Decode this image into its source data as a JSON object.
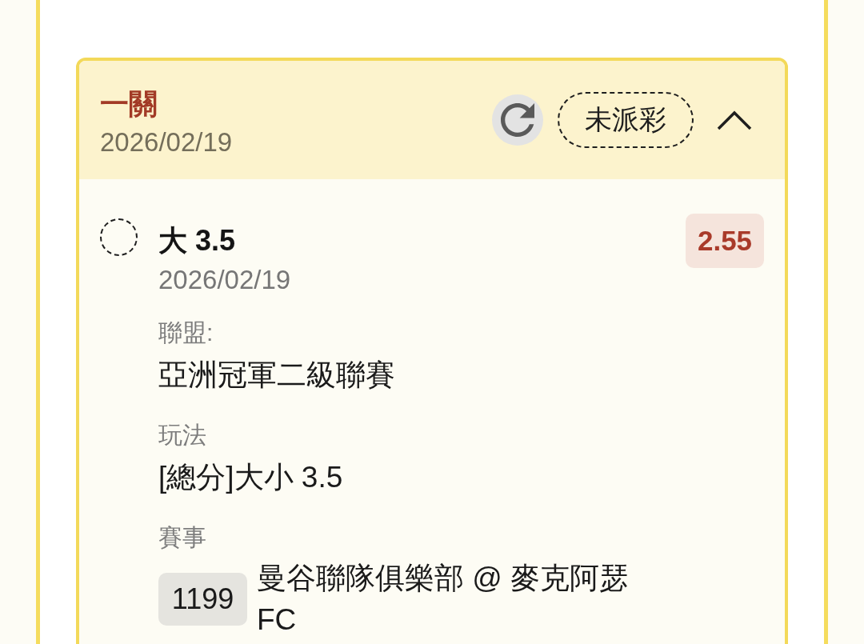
{
  "bet": {
    "type": "一關",
    "date": "2026/02/19",
    "status": "未派彩",
    "expanded": true,
    "selections": [
      {
        "selected": false,
        "pick": "大 3.5",
        "date": "2026/02/19",
        "odds": "2.55",
        "fields": [
          {
            "kind": "text",
            "label": "聯盟:",
            "value": "亞洲冠軍二級聯賽"
          },
          {
            "kind": "text",
            "label": "玩法",
            "value": "[總分]大小 3.5"
          },
          {
            "kind": "match",
            "label": "賽事",
            "match_no": "1199",
            "value": "曼谷聯隊俱樂部 @ 麥克阿瑟 FC"
          }
        ]
      }
    ]
  }
}
